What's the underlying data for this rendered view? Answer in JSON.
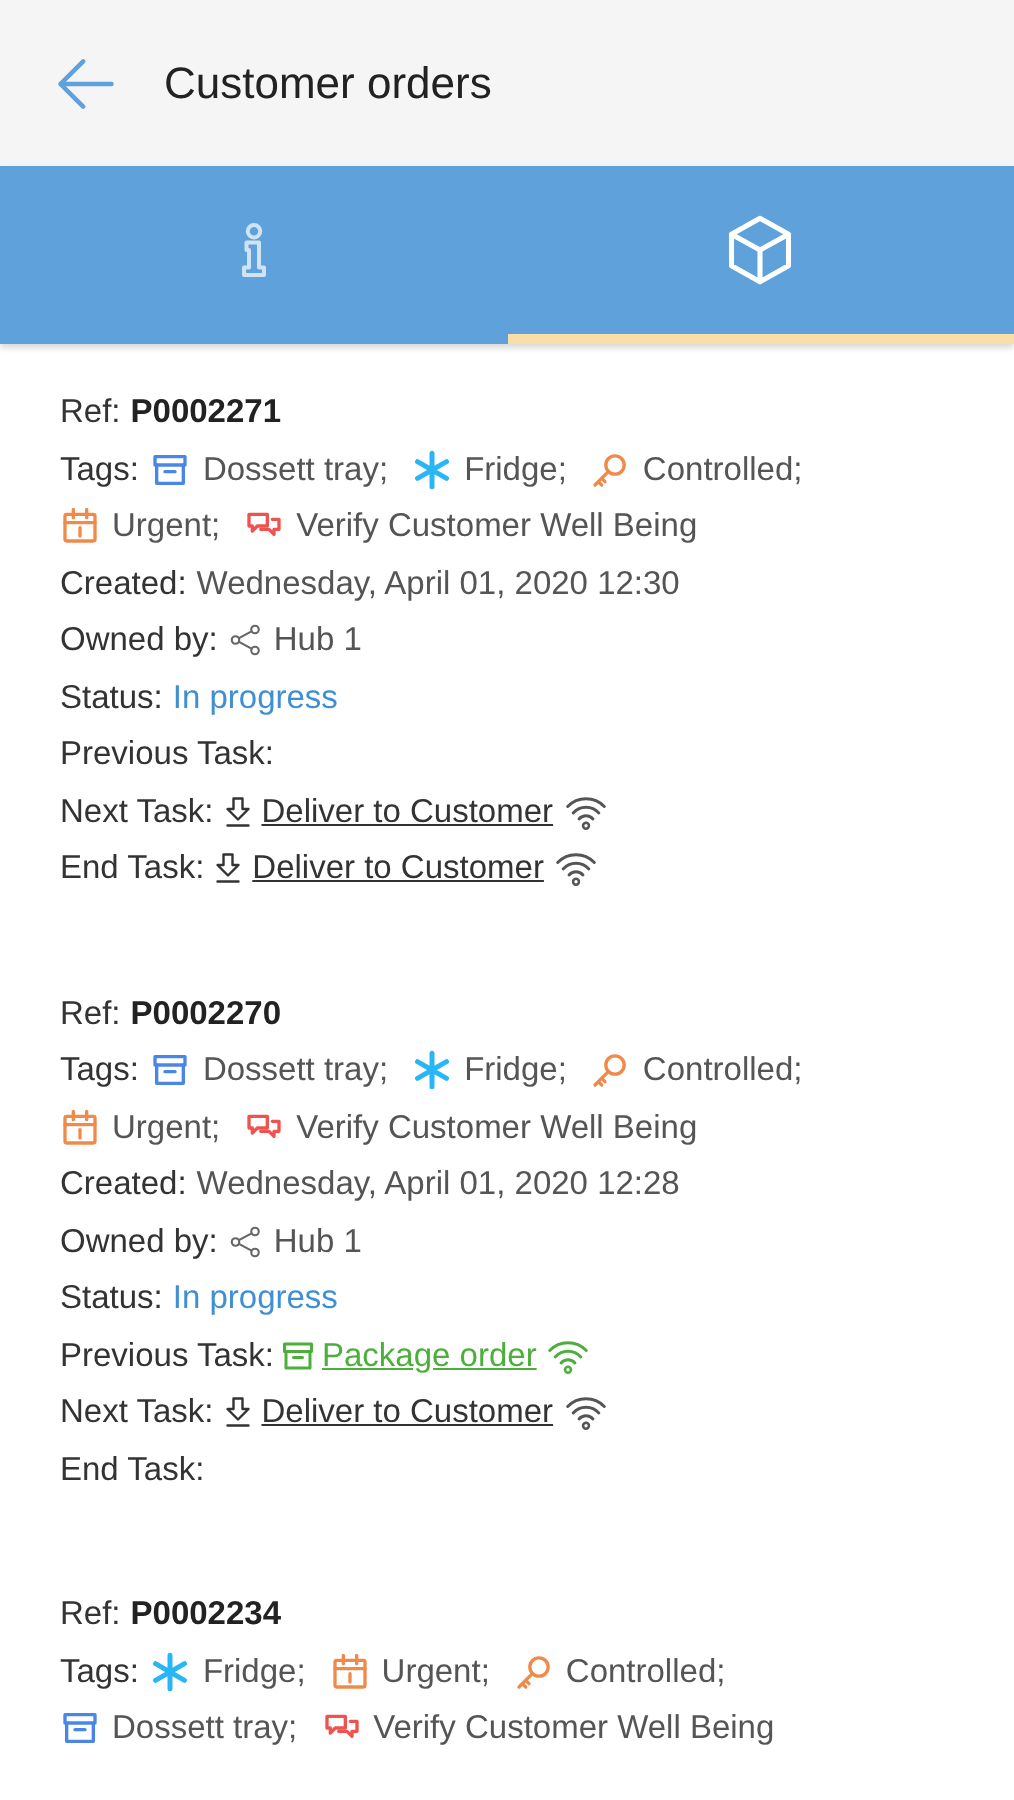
{
  "header": {
    "title": "Customer orders"
  },
  "tabs": [
    {
      "kind": "info",
      "selected": false
    },
    {
      "kind": "box",
      "selected": true
    }
  ],
  "orders": [
    {
      "fields": [
        {
          "kind": "ref",
          "label": "Ref:",
          "value": "P0002271"
        },
        {
          "kind": "tags",
          "label": "Tags:",
          "tags": [
            {
              "kind": "tray",
              "label": "Dossett tray;"
            },
            {
              "kind": "fridge",
              "label": "Fridge;"
            },
            {
              "kind": "key",
              "label": "Controlled;"
            },
            {
              "kind": "calendar",
              "label": "Urgent;"
            },
            {
              "kind": "chat",
              "label": "Verify Customer Well Being"
            }
          ]
        },
        {
          "kind": "text",
          "label": "Created:",
          "value": "Wednesday, April 01, 2020 12:30"
        },
        {
          "kind": "owner",
          "label": "Owned by:",
          "value": "Hub 1"
        },
        {
          "kind": "status",
          "label": "Status:",
          "value": "In progress"
        },
        {
          "kind": "task",
          "label": "Previous Task:"
        },
        {
          "kind": "task",
          "label": "Next Task:",
          "task": {
            "kind": "deliver",
            "value": "Deliver to Customer",
            "color": "#333333"
          }
        },
        {
          "kind": "task",
          "label": "End Task:",
          "task": {
            "kind": "deliver",
            "value": "Deliver to Customer",
            "color": "#333333"
          }
        }
      ]
    },
    {
      "fields": [
        {
          "kind": "ref",
          "label": "Ref:",
          "value": "P0002270"
        },
        {
          "kind": "tags",
          "label": "Tags:",
          "tags": [
            {
              "kind": "tray",
              "label": "Dossett tray;"
            },
            {
              "kind": "fridge",
              "label": "Fridge;"
            },
            {
              "kind": "key",
              "label": "Controlled;"
            },
            {
              "kind": "calendar",
              "label": "Urgent;"
            },
            {
              "kind": "chat",
              "label": "Verify Customer Well Being"
            }
          ]
        },
        {
          "kind": "text",
          "label": "Created:",
          "value": "Wednesday, April 01, 2020 12:28"
        },
        {
          "kind": "owner",
          "label": "Owned by:",
          "value": "Hub 1"
        },
        {
          "kind": "status",
          "label": "Status:",
          "value": "In progress"
        },
        {
          "kind": "task",
          "label": "Previous Task:",
          "task": {
            "kind": "package",
            "value": "Package order",
            "color": "#4caf3c"
          }
        },
        {
          "kind": "task",
          "label": "Next Task:",
          "task": {
            "kind": "deliver",
            "value": "Deliver to Customer",
            "color": "#333333"
          }
        },
        {
          "kind": "task",
          "label": "End Task:"
        }
      ]
    },
    {
      "fields": [
        {
          "kind": "ref",
          "label": "Ref:",
          "value": "P0002234"
        },
        {
          "kind": "tags",
          "label": "Tags:",
          "tags": [
            {
              "kind": "fridge",
              "label": "Fridge;"
            },
            {
              "kind": "calendar",
              "label": "Urgent;"
            },
            {
              "kind": "key",
              "label": "Controlled;"
            },
            {
              "kind": "tray",
              "label": "Dossett tray;"
            },
            {
              "kind": "chat",
              "label": "Verify Customer Well Being"
            }
          ]
        }
      ]
    }
  ]
}
